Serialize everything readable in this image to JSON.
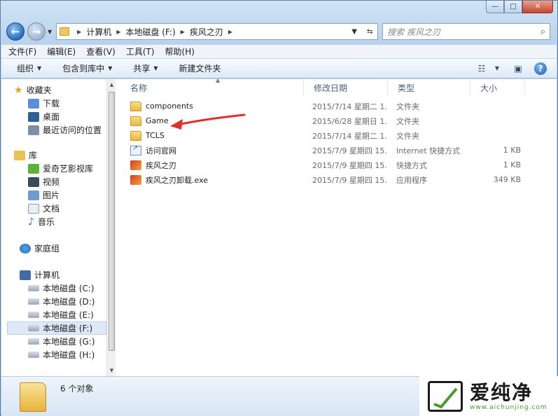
{
  "window": {
    "caption": {
      "minimize": "—",
      "maximize": "□",
      "close": "✕"
    }
  },
  "nav": {
    "back": "←",
    "forward": "→",
    "breadcrumb": [
      "计算机",
      "本地磁盘 (F:)",
      "疾风之刃"
    ],
    "search_placeholder": "搜索 疾风之刃"
  },
  "menu": [
    "文件(F)",
    "编辑(E)",
    "查看(V)",
    "工具(T)",
    "帮助(H)"
  ],
  "toolbar": {
    "organize": "组织",
    "include_library": "包含到库中",
    "share": "共享",
    "new_folder": "新建文件夹"
  },
  "sidebar": {
    "favorites": {
      "label": "收藏夹",
      "items": [
        "下载",
        "桌面",
        "最近访问的位置"
      ]
    },
    "libraries": {
      "label": "库",
      "items": [
        "爱奇艺影视库",
        "视频",
        "图片",
        "文档",
        "音乐"
      ]
    },
    "homegroup": {
      "label": "家庭组"
    },
    "computer": {
      "label": "计算机",
      "items": [
        "本地磁盘 (C:)",
        "本地磁盘 (D:)",
        "本地磁盘 (E:)",
        "本地磁盘 (F:)",
        "本地磁盘 (G:)",
        "本地磁盘 (H:)"
      ],
      "selected_index": 3
    }
  },
  "columns": {
    "name": "名称",
    "date": "修改日期",
    "type": "类型",
    "size": "大小"
  },
  "files": [
    {
      "name": "components",
      "date": "2015/7/14 星期二 1...",
      "type": "文件夹",
      "size": "",
      "icon": "folder-icon"
    },
    {
      "name": "Game",
      "date": "2015/6/28 星期日 1...",
      "type": "文件夹",
      "size": "",
      "icon": "folder-icon"
    },
    {
      "name": "TCLS",
      "date": "2015/7/14 星期二 1...",
      "type": "文件夹",
      "size": "",
      "icon": "folder-icon"
    },
    {
      "name": "访问官网",
      "date": "2015/7/9 星期四 15...",
      "type": "Internet 快捷方式",
      "size": "1 KB",
      "icon": "internet-shortcut-icon"
    },
    {
      "name": "疾风之刃",
      "date": "2015/7/9 星期四 15...",
      "type": "快捷方式",
      "size": "1 KB",
      "icon": "game-shortcut-icon"
    },
    {
      "name": "疾风之刃卸载.exe",
      "date": "2015/7/9 星期四 15...",
      "type": "应用程序",
      "size": "349 KB",
      "icon": "uninstaller-icon"
    }
  ],
  "status": {
    "count": "6 个对象"
  },
  "watermark": {
    "brand": "爱纯净",
    "url": "www.aichunjing.com"
  },
  "colors": {
    "arrow": "#e0302a",
    "selected_bg": "#dde9f6"
  }
}
